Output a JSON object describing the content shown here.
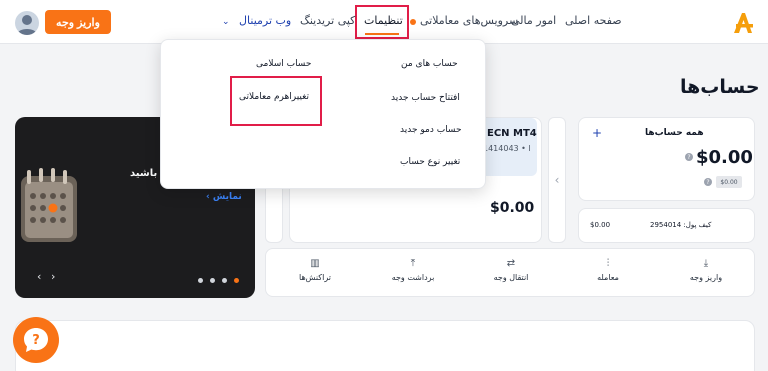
{
  "header": {
    "logo_letter": "A",
    "nav": {
      "home": "صفحه اصلی",
      "financial": "امور مالی",
      "trading_services": "سرویس‌های معاملاتی",
      "settings": "تنظیمات",
      "copy_trading": "کپی تریدینگ",
      "web_terminal": "وب ترمینال"
    },
    "deposit_button": "واریز وجه"
  },
  "dropdown": {
    "my_accounts": "حساب های من",
    "islamic_account": "حساب اسلامی",
    "open_new_account": "افتتاح حساب جدید",
    "change_leverage": "تغییراهرم معاملاتی",
    "new_demo_account": "حساب دمو جدید",
    "change_account_type": "تغییر نوع حساب"
  },
  "page": {
    "title": "حساب‌ها"
  },
  "promo": {
    "text": "ر باشید",
    "link": "نمایش",
    "link_arrow": "‹",
    "arrow_left": "‹",
    "arrow_right": "›"
  },
  "accounts": {
    "all_accounts_title": "همه حساب‌ها",
    "plus": "+",
    "total_balance": "$0.00",
    "badge": "$0.00",
    "info": "?",
    "wallet_label": "کیف پول: 2954014",
    "wallet_value": "$0.00",
    "ecn_title": "ECN MT4",
    "ecn_sub": "1414043 • ا",
    "ecn_balance": "$0.00",
    "arrow_right": "‹",
    "arrow_left": "›"
  },
  "actions": {
    "deposit": "واریز وجه",
    "trade": "معامله",
    "transfer": "انتقال وجه",
    "withdraw": "برداشت وجه",
    "transactions": "تراکنش‌ها"
  },
  "colors": {
    "accent": "#f97316",
    "highlight": "#e11d48",
    "link": "#1e40af"
  }
}
